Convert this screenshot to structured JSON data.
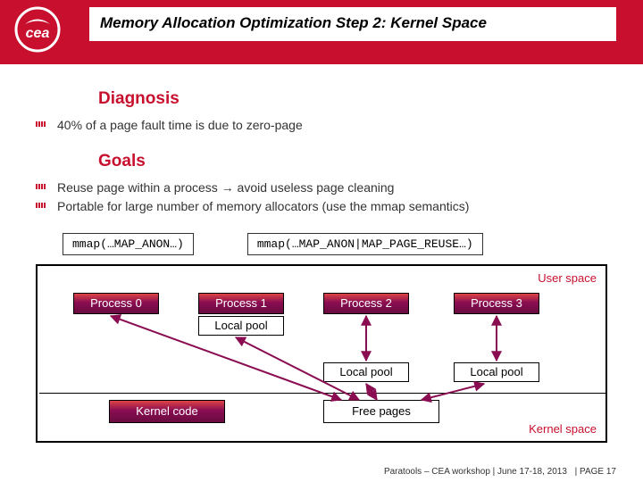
{
  "title": "Memory Allocation Optimization Step 2: Kernel Space",
  "sections": {
    "diagnosis": {
      "heading": "Diagnosis",
      "items": [
        "40% of a page fault time is due to zero-page"
      ]
    },
    "goals": {
      "heading": "Goals",
      "items": [
        "Reuse page within a process → avoid useless page cleaning",
        "Portable for large number of memory allocators (use the mmap semantics)"
      ]
    }
  },
  "code": {
    "before": "mmap(…MAP_ANON…)",
    "after": "mmap(…MAP_ANON|MAP_PAGE_REUSE…)"
  },
  "diagram": {
    "user_space_label": "User space",
    "kernel_space_label": "Kernel space",
    "processes": [
      "Process 0",
      "Process 1",
      "Process 2",
      "Process 3"
    ],
    "local_pool_label": "Local pool",
    "kernel_code_label": "Kernel code",
    "free_pages_label": "Free pages"
  },
  "footer": {
    "text": "Paratools – CEA workshop | June 17-18, 2013",
    "page": "| PAGE 17"
  },
  "chart_data": {
    "type": "table",
    "title": "Memory Allocation Optimization Step 2: Kernel Space",
    "diagnosis_page_fault_time_due_to_zero_page_percent": 40,
    "code_transform": {
      "from": "mmap(…MAP_ANON…)",
      "to": "mmap(…MAP_ANON|MAP_PAGE_REUSE…)"
    },
    "diagram_nodes": [
      {
        "id": "process0",
        "label": "Process 0",
        "layer": "user"
      },
      {
        "id": "process1",
        "label": "Process 1",
        "layer": "user"
      },
      {
        "id": "process2",
        "label": "Process 2",
        "layer": "user"
      },
      {
        "id": "process3",
        "label": "Process 3",
        "layer": "user"
      },
      {
        "id": "localpool1",
        "label": "Local pool",
        "layer": "user",
        "parent": "process1"
      },
      {
        "id": "localpool2",
        "label": "Local pool",
        "layer": "user",
        "parent": "process2"
      },
      {
        "id": "localpool3",
        "label": "Local pool",
        "layer": "user",
        "parent": "process3"
      },
      {
        "id": "kernelcode",
        "label": "Kernel code",
        "layer": "kernel"
      },
      {
        "id": "freepages",
        "label": "Free pages",
        "layer": "kernel"
      }
    ],
    "diagram_edges": [
      {
        "from": "process0",
        "to": "freepages",
        "bidirectional": true
      },
      {
        "from": "process1",
        "to": "freepages",
        "bidirectional": true
      },
      {
        "from": "process2",
        "to": "localpool2",
        "bidirectional": true
      },
      {
        "from": "process3",
        "to": "localpool3",
        "bidirectional": true
      },
      {
        "from": "localpool2",
        "to": "freepages",
        "bidirectional": true
      },
      {
        "from": "localpool3",
        "to": "freepages",
        "bidirectional": true
      }
    ]
  }
}
